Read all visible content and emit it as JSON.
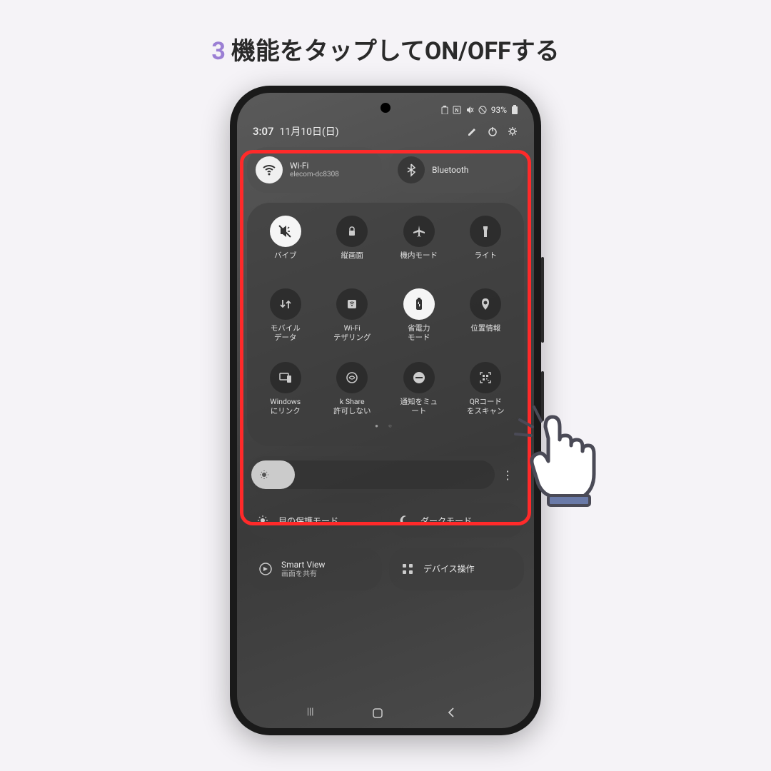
{
  "title": {
    "num": "3",
    "text": "機能をタップしてON/OFFする"
  },
  "status": {
    "battery": "93%"
  },
  "header": {
    "time": "3:07",
    "date": "11月10日(日)"
  },
  "wifi": {
    "label": "Wi-Fi",
    "sub": "elecom-dc8308"
  },
  "bluetooth": {
    "label": "Bluetooth"
  },
  "tiles": {
    "vibrate": "バイブ",
    "rotation": "縦画面",
    "airplane": "機内モード",
    "flashlight": "ライト",
    "mobiledata": "モバイル\nデータ",
    "tethering": "Wi-Fi\nテザリング",
    "powersave": "省電力\nモード",
    "location": "位置情報",
    "windowslink": "Windows\nにリンク",
    "quickshare": "k Share\n許可しない",
    "mute": "通知をミュ\nート",
    "qrscan": "QRコード\nをスキャン"
  },
  "modes": {
    "eye": "目の保護モード",
    "dark": "ダークモード"
  },
  "bottom": {
    "smartview": {
      "label": "Smart View",
      "sub": "画面を共有"
    },
    "device": {
      "label": "デバイス操作"
    }
  }
}
